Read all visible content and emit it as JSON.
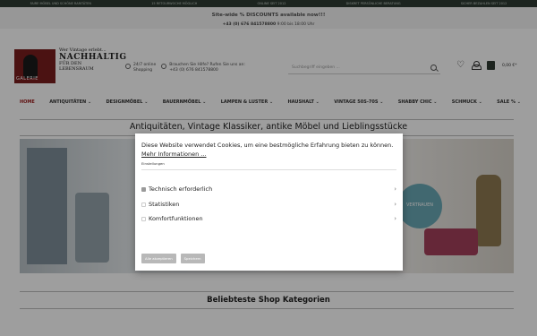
{
  "topbar": {
    "items": [
      "FAIRE MÖBEL UND SCHÖNE RARITÄTEN",
      "15 RETOURWOCHE MÖGLICH",
      "ONLINE SEIT 2012",
      "DISKRET PERSÖNLICHE BERATUNG",
      "SICHER BEZAHLEN SEIT 2012"
    ]
  },
  "promo": {
    "headline": "Site-wide % DISCOUNTS available now!!!",
    "phone": "+43 (0) 676 841578800",
    "hours": " 9:00 bis 18:00 Uhr"
  },
  "header": {
    "logo_text": "GALERIE",
    "slogan_top": "Wer Vintage erlebt...",
    "slogan_main": "NACHHALTIG",
    "slogan_bottom": "FÜR DEN LEBENSRAUM",
    "support_1": "24/7 online\nShopping",
    "support_2": "Brauchen Sie Hilfe? Rufen Sie uns an:\n+43 (0) 676 841578800",
    "search_placeholder": "Suchbegriff eingeben ...",
    "cart_price": "0,00 €*"
  },
  "nav": {
    "items": [
      "HOME",
      "ANTIQUITÄTEN ⌄",
      "DESIGNMÖBEL ⌄",
      "BAUERNMÖBEL ⌄",
      "LAMPEN & LUSTER ⌄",
      "HAUSHALT ⌄",
      "VINTAGE 50S-70S ⌄",
      "SHABBY CHIC ⌄",
      "SCHMUCK ⌄",
      "SALE % ⌄"
    ]
  },
  "page": {
    "title": "Antiquitäten, Vintage Klassiker, antike Möbel und Lieblingsstücke",
    "hero_badge": "VERTRAUEN",
    "section_title": "Beliebteste Shop Kategorien"
  },
  "cookie": {
    "message": "Diese Website verwendet Cookies, um eine bestmögliche Erfahrung bieten zu können.",
    "more_link": "Mehr Informationen ...",
    "settings_label": "Einstellungen",
    "options": [
      {
        "label": "Technisch erforderlich",
        "checked": true
      },
      {
        "label": "Statistiken",
        "checked": false
      },
      {
        "label": "Komfortfunktionen",
        "checked": false
      }
    ],
    "accept_all": "Alle akzeptieren",
    "save": "Speichern"
  },
  "colors": {
    "topbar": "#2e3b33",
    "active_nav": "#9b1c1c",
    "button": "#b8b8b8"
  }
}
